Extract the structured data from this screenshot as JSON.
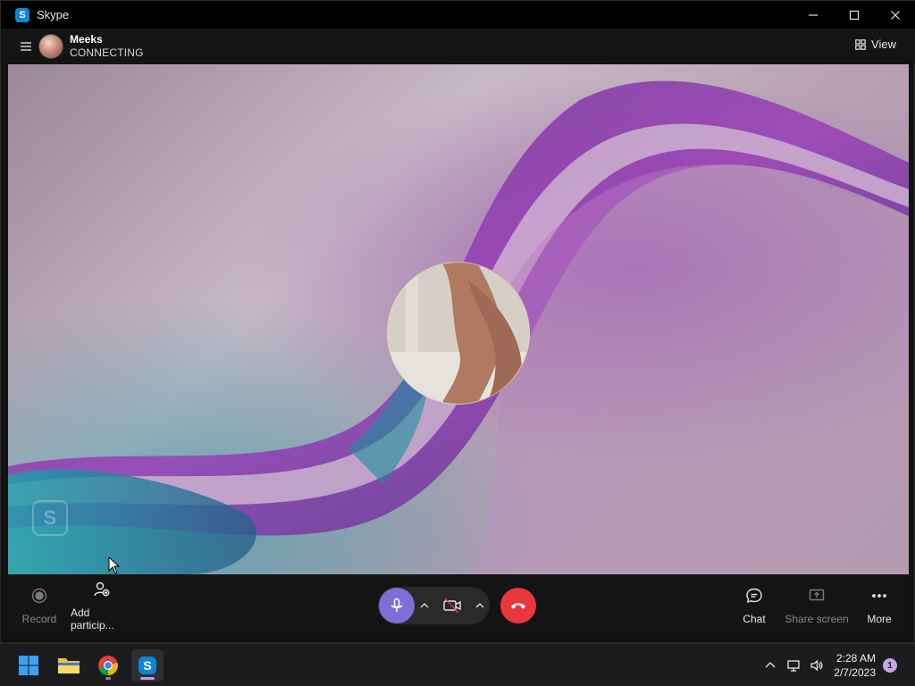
{
  "window": {
    "title": "Skype",
    "app_icon_letter": "S",
    "controls": {
      "minimize_icon": "minimize-icon",
      "maximize_icon": "maximize-icon",
      "close_icon": "close-icon"
    }
  },
  "call_header": {
    "menu_icon": "hamburger-icon",
    "caller_name": "Meeks",
    "caller_status": "CONNECTING",
    "view_label": "View",
    "view_icon": "grid-icon"
  },
  "video": {
    "watermark_letter": "S",
    "colors": {
      "purple": "#8c3caa",
      "teal": "#1496a0",
      "mauve": "#b8a2b4"
    }
  },
  "controls": {
    "record_label": "Record",
    "add_participants_label": "Add particip...",
    "chat_label": "Chat",
    "share_screen_label": "Share screen",
    "more_label": "More",
    "mic_color": "#7d6ed8",
    "end_call_color": "#e8383d"
  },
  "taskbar": {
    "apps": [
      "start",
      "file-explorer",
      "chrome",
      "skype"
    ],
    "active_app": "skype",
    "clock_time": "2:28 AM",
    "clock_date": "2/7/2023",
    "notification_count": "1"
  }
}
